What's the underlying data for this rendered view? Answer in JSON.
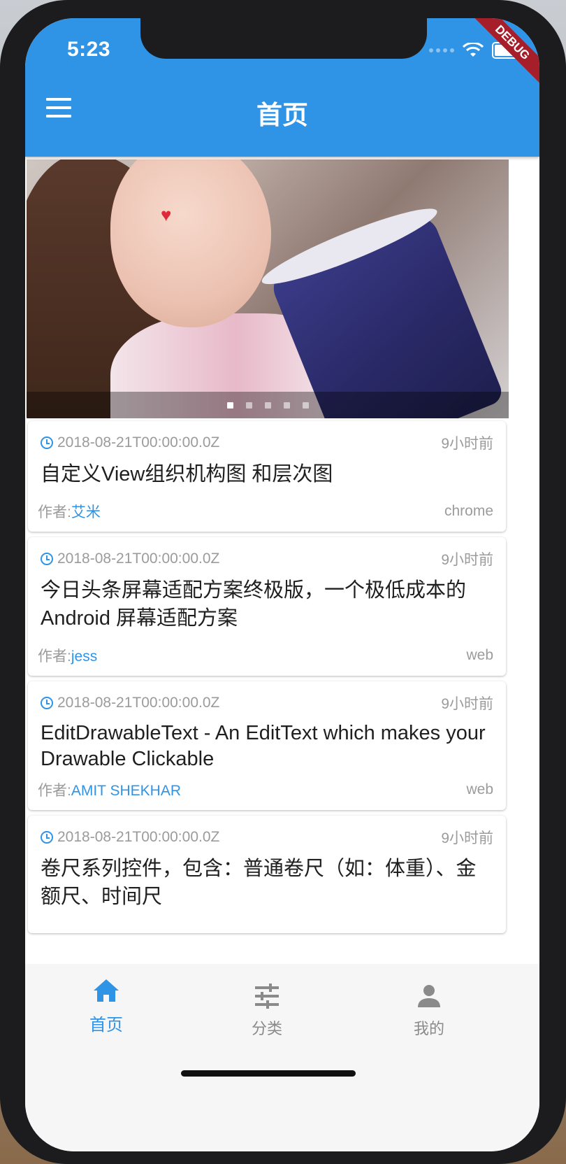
{
  "status_bar": {
    "time": "5:23",
    "debug_label": "DEBUG"
  },
  "app_bar": {
    "title": "首页",
    "menu_icon": "hamburger-menu-icon"
  },
  "carousel": {
    "dot_count": 5,
    "active_index": 0
  },
  "articles": [
    {
      "date": "2018-08-21T00:00:00.0Z",
      "ago": "9小时前",
      "title": "自定义View组织机构图 和层次图",
      "author_label": "作者:",
      "author": "艾米",
      "source": "chrome"
    },
    {
      "date": "2018-08-21T00:00:00.0Z",
      "ago": "9小时前",
      "title": "今日头条屏幕适配方案终极版，一个极低成本的 Android 屏幕适配方案",
      "author_label": "作者:",
      "author": "jess",
      "source": "web"
    },
    {
      "date": "2018-08-21T00:00:00.0Z",
      "ago": "9小时前",
      "title": "EditDrawableText - An EditText which makes your Drawable Clickable",
      "author_label": "作者:",
      "author": "AMIT SHEKHAR",
      "source": "web"
    },
    {
      "date": "2018-08-21T00:00:00.0Z",
      "ago": "9小时前",
      "title": "卷尺系列控件，包含：普通卷尺（如：体重）、金额尺、时间尺",
      "author_label": "",
      "author": "",
      "source": ""
    }
  ],
  "bottom_nav": [
    {
      "label": "首页",
      "icon": "home-icon",
      "active": true
    },
    {
      "label": "分类",
      "icon": "tune-icon",
      "active": false
    },
    {
      "label": "我的",
      "icon": "person-icon",
      "active": false
    }
  ],
  "colors": {
    "primary": "#2f93e6",
    "text": "#1f1f1f",
    "muted": "#9b9b9b",
    "debug": "#a51e2a"
  }
}
